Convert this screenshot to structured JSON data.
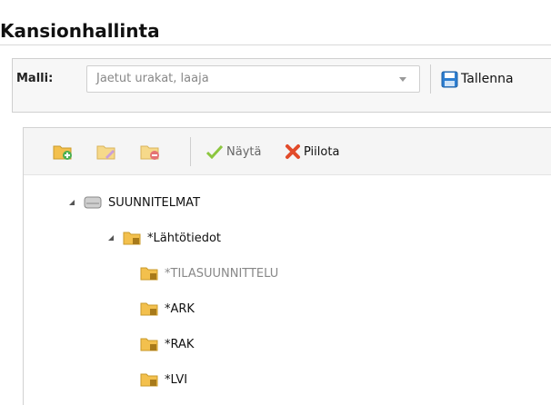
{
  "panel": {
    "title": "Kansionhallinta"
  },
  "toolbar": {
    "template_label": "Malli:",
    "template_value": "Jaetut urakat, laaja",
    "save_label": "Tallenna"
  },
  "tree_toolbar": {
    "show_label": "Näytä",
    "hide_label": "Piilota"
  },
  "tree": {
    "root": {
      "label": "SUUNNITELMAT",
      "icon": "drive-icon",
      "expanded": true
    },
    "folder": {
      "label": "*Lähtötiedot",
      "icon": "locked-folder-icon",
      "expanded": true
    },
    "children": [
      {
        "label": "*TILASUUNNITTELU",
        "icon": "locked-folder-icon",
        "dimmed": true
      },
      {
        "label": "*ARK",
        "icon": "locked-folder-icon",
        "dimmed": false
      },
      {
        "label": "*RAK",
        "icon": "locked-folder-icon",
        "dimmed": false
      },
      {
        "label": "*LVI",
        "icon": "locked-folder-icon",
        "dimmed": false
      }
    ]
  },
  "colors": {
    "show_check": "#8cc63f",
    "hide_cross": "#e24b2a",
    "folder": "#f3c04d",
    "dimmed_text": "#888888"
  }
}
